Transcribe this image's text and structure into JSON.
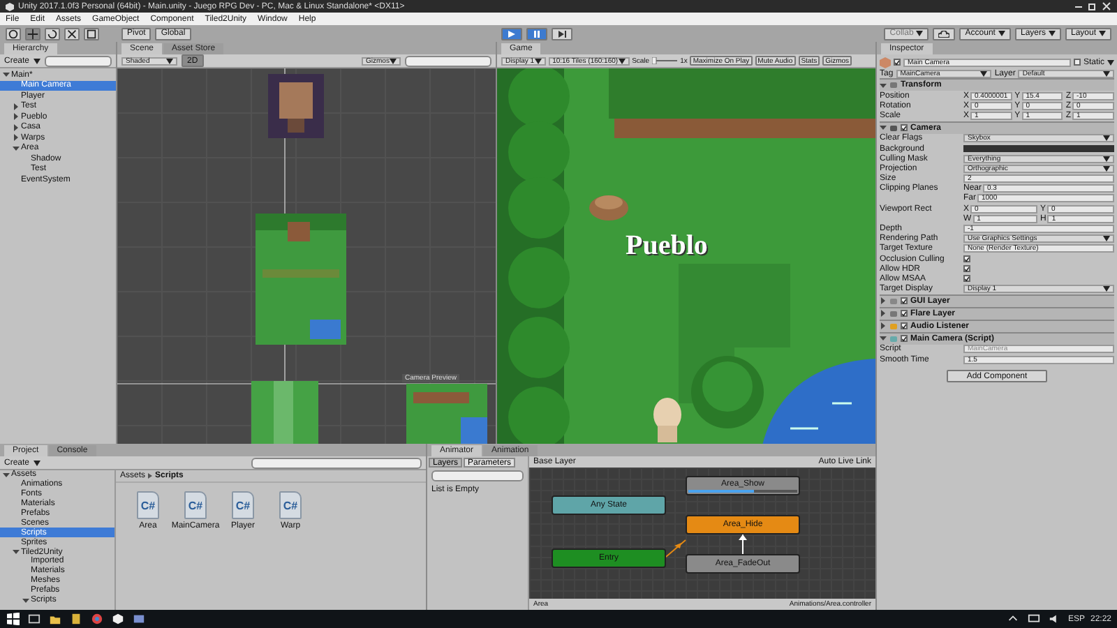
{
  "window": {
    "title": "Unity 2017.1.0f3 Personal (64bit) - Main.unity - Juego RPG Dev - PC, Mac & Linux Standalone* <DX11>"
  },
  "menu": [
    "File",
    "Edit",
    "Assets",
    "GameObject",
    "Component",
    "Tiled2Unity",
    "Window",
    "Help"
  ],
  "toolbar": {
    "tools": [
      {
        "kind": "hand",
        "selected": false
      },
      {
        "kind": "move",
        "selected": true
      },
      {
        "kind": "rotate",
        "selected": false
      },
      {
        "kind": "scale",
        "selected": false
      },
      {
        "kind": "rect",
        "selected": false
      }
    ],
    "pivot": "Pivot",
    "space": "Global",
    "playing": true,
    "paused": true,
    "collab": "Collab",
    "buttons": [
      "Account",
      "Layers",
      "Layout"
    ]
  },
  "hierarchy": {
    "tab": "Hierarchy",
    "create": "Create",
    "items": [
      {
        "label": "Main*",
        "expanded": true,
        "selected": false,
        "children": [
          {
            "label": "Main Camera",
            "selected": true
          },
          {
            "label": "Player",
            "selected": false
          },
          {
            "label": "Test",
            "expanded": false,
            "selected": false
          },
          {
            "label": "Pueblo",
            "expanded": false,
            "selected": false
          },
          {
            "label": "Casa",
            "expanded": false,
            "selected": false
          },
          {
            "label": "Warps",
            "expanded": false,
            "selected": false
          },
          {
            "label": "Area",
            "expanded": true,
            "selected": false,
            "children": [
              {
                "label": "Shadow",
                "selected": false
              },
              {
                "label": "Test",
                "selected": false
              }
            ]
          },
          {
            "label": "EventSystem",
            "selected": false
          }
        ]
      }
    ]
  },
  "scene": {
    "tabs": [
      {
        "label": "Scene",
        "selected": true
      },
      {
        "label": "Asset Store",
        "selected": false
      }
    ],
    "shading": "Shaded",
    "mode": "2D",
    "gizmos": "Gizmos",
    "camera_preview": "Camera Preview"
  },
  "game": {
    "tab": "Game",
    "display": "Display 1",
    "aspect": "10:16 Tiles (160:160)",
    "scale_label": "Scale",
    "scale_value": "1x",
    "scale_slider": {
      "level": 0
    },
    "toggles": [
      {
        "label": "Maximize On Play",
        "on": false
      },
      {
        "label": "Mute Audio",
        "on": false
      },
      {
        "label": "Stats",
        "on": false
      },
      {
        "label": "Gizmos",
        "on": false
      }
    ],
    "caption": "Pueblo"
  },
  "inspector": {
    "tab": "Inspector",
    "active": true,
    "name": "Main Camera",
    "static_label": "Static",
    "static": false,
    "tag_label": "Tag",
    "tag": "MainCamera",
    "layer_label": "Layer",
    "layer": "Default",
    "components": [
      {
        "name": "Transform",
        "kind": "transform",
        "expanded": true,
        "rows": [
          {
            "kind": "xyz",
            "label": "Position",
            "fields": [
              {
                "axis": "X",
                "value": "0.4000001"
              },
              {
                "axis": "Y",
                "value": "15.4"
              },
              {
                "axis": "Z",
                "value": "-10"
              }
            ]
          },
          {
            "kind": "xyz",
            "label": "Rotation",
            "fields": [
              {
                "axis": "X",
                "value": "0"
              },
              {
                "axis": "Y",
                "value": "0"
              },
              {
                "axis": "Z",
                "value": "0"
              }
            ]
          },
          {
            "kind": "xyz",
            "label": "Scale",
            "fields": [
              {
                "axis": "X",
                "value": "1"
              },
              {
                "axis": "Y",
                "value": "1"
              },
              {
                "axis": "Z",
                "value": "1"
              }
            ]
          }
        ]
      },
      {
        "name": "Camera",
        "kind": "camera",
        "enabled": true,
        "expanded": true,
        "rows": [
          {
            "kind": "dropdown",
            "label": "Clear Flags",
            "value": "Skybox"
          },
          {
            "kind": "color",
            "label": "Background",
            "color": "#313131"
          },
          {
            "kind": "dropdown",
            "label": "Culling Mask",
            "value": "Everything"
          },
          {
            "kind": "dropdown",
            "label": "Projection",
            "value": "Orthographic"
          },
          {
            "kind": "field",
            "label": "Size",
            "value": "2"
          },
          {
            "kind": "xyz",
            "label": "Clipping Planes",
            "fields": [
              {
                "axis": "Near",
                "value": "0.3"
              }
            ]
          },
          {
            "kind": "xyz",
            "label": "",
            "fields": [
              {
                "axis": "Far",
                "value": "1000"
              }
            ]
          },
          {
            "kind": "xyz",
            "label": "Viewport Rect",
            "fields": [
              {
                "axis": "X",
                "value": "0"
              },
              {
                "axis": "Y",
                "value": "0"
              }
            ]
          },
          {
            "kind": "xyz",
            "label": "",
            "fields": [
              {
                "axis": "W",
                "value": "1"
              },
              {
                "axis": "H",
                "value": "1"
              }
            ]
          },
          {
            "kind": "field",
            "label": "Depth",
            "value": "-1"
          },
          {
            "kind": "dropdown",
            "label": "Rendering Path",
            "value": "Use Graphics Settings"
          },
          {
            "kind": "object",
            "label": "Target Texture",
            "value": "None (Render Texture)"
          },
          {
            "kind": "check",
            "label": "Occlusion Culling",
            "checked": true
          },
          {
            "kind": "check",
            "label": "Allow HDR",
            "checked": true
          },
          {
            "kind": "check",
            "label": "Allow MSAA",
            "checked": true
          },
          {
            "kind": "dropdown",
            "label": "Target Display",
            "value": "Display 1"
          }
        ]
      },
      {
        "name": "GUI Layer",
        "kind": "gui",
        "enabled": true,
        "expanded": false
      },
      {
        "name": "Flare Layer",
        "kind": "flare",
        "enabled": true,
        "expanded": false
      },
      {
        "name": "Audio Listener",
        "kind": "audio",
        "enabled": true,
        "expanded": false
      },
      {
        "name": "Main Camera (Script)",
        "kind": "script",
        "enabled": true,
        "expanded": true,
        "rows": [
          {
            "kind": "field",
            "label": "Script",
            "value": "MainCamera",
            "disabled": true
          },
          {
            "kind": "field",
            "label": "Smooth Time",
            "value": "1.5"
          }
        ]
      }
    ],
    "add_component": "Add Component"
  },
  "project": {
    "tabs": [
      {
        "label": "Project",
        "selected": true
      },
      {
        "label": "Console",
        "selected": false
      }
    ],
    "create": "Create",
    "tree": [
      {
        "label": "Assets",
        "expanded": true,
        "selected": false,
        "children": [
          {
            "label": "Animations",
            "selected": false
          },
          {
            "label": "Fonts",
            "selected": false
          },
          {
            "label": "Materials",
            "selected": false
          },
          {
            "label": "Prefabs",
            "selected": false
          },
          {
            "label": "Scenes",
            "selected": false
          },
          {
            "label": "Scripts",
            "selected": true
          },
          {
            "label": "Sprites",
            "selected": false
          },
          {
            "label": "Tiled2Unity",
            "expanded": true,
            "selected": false,
            "children": [
              {
                "label": "Imported",
                "selected": false
              },
              {
                "label": "Materials",
                "selected": false
              },
              {
                "label": "Meshes",
                "selected": false
              },
              {
                "label": "Prefabs",
                "selected": false
              },
              {
                "label": "Scripts",
                "expanded": true,
                "selected": false
              }
            ]
          }
        ]
      }
    ],
    "breadcrumb": [
      "Assets",
      "Scripts"
    ],
    "files": [
      {
        "name": "Area",
        "icon_label": "C#"
      },
      {
        "name": "MainCamera",
        "icon_label": "C#"
      },
      {
        "name": "Player",
        "icon_label": "C#"
      },
      {
        "name": "Warp",
        "icon_label": "C#"
      }
    ]
  },
  "animator": {
    "tabs": [
      {
        "label": "Animator",
        "selected": true
      },
      {
        "label": "Animation",
        "selected": false
      }
    ],
    "pane_tabs": [
      {
        "label": "Layers",
        "selected": false
      },
      {
        "label": "Parameters",
        "selected": true
      }
    ],
    "empty_text": "List is Empty",
    "layer": "Base Layer",
    "live_link": "Auto Live Link",
    "states": [
      {
        "name": "Any State",
        "kind": "any"
      },
      {
        "name": "Area_Show",
        "kind": "normal",
        "level": 0.6
      },
      {
        "name": "Area_Hide",
        "kind": "default"
      },
      {
        "name": "Entry",
        "kind": "entry"
      },
      {
        "name": "Area_FadeOut",
        "kind": "normal"
      }
    ],
    "footer_left": "Area",
    "footer_right": "Animations/Area.controller"
  },
  "taskbar": {
    "language": "ESP",
    "time": "22:22"
  }
}
